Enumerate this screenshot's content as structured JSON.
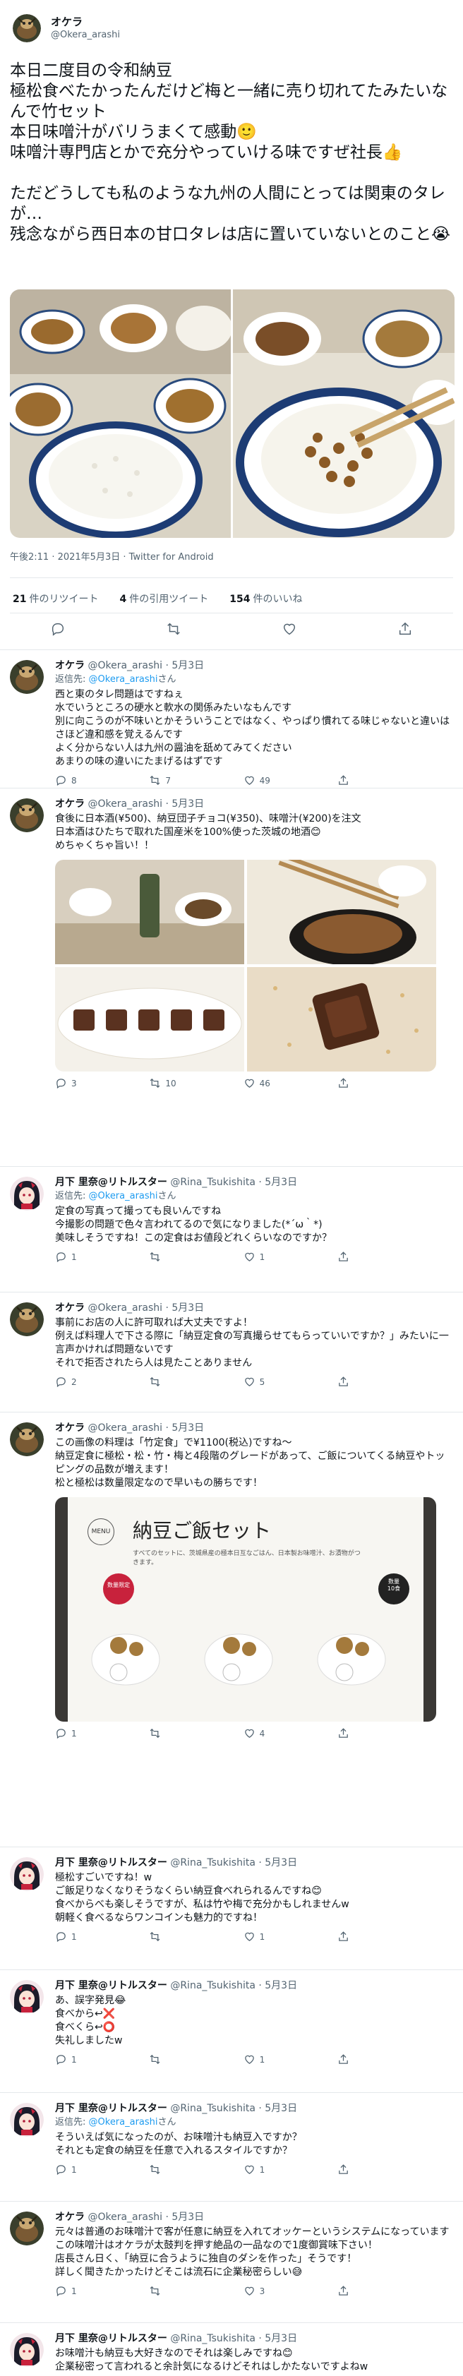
{
  "main": {
    "name": "オケラ",
    "handle": "@Okera_arashi",
    "text": "本日二度目の令和納豆\n極松食べたかったんだけど梅と一緒に売り切れてたみたいなんで竹セット\n本日味噌汁がバリうまくて感動🙂\n味噌汁専門店とかで充分やっていける味ですぜ社長👍\n\nただどうしても私のような九州の人間にとっては関東のタレが…\n残念ながら西日本の甘口タレは店に置いていないとのこと😭",
    "meta": "午後2:11 · 2021年5月3日 · Twitter for Android",
    "retweets_count": "21",
    "retweets_label": "件のリツイート",
    "quotes_count": "4",
    "quotes_label": "件の引用ツイート",
    "likes_count": "154",
    "likes_label": "件のいいね"
  },
  "replies": [
    {
      "name": "オケラ",
      "handle": "@Okera_arashi",
      "time": "· 5月3日",
      "replyto_prefix": "返信先: ",
      "replyto": "@Okera_arashi",
      "replyto_suffix": "さん",
      "text": "西と東のタレ問題はですねぇ\n水でいうところの硬水と軟水の関係みたいなもんです\n別に向こうのが不味いとかそういうことではなく、やっぱり慣れてる味じゃないと違いはさほど違和感を覚えるんです\nよく分からない人は九州の醤油を舐めてみてください\nあまりの味の違いにたまげるはずです",
      "reply_count": "8",
      "retweet_count": "7",
      "like_count": "49"
    },
    {
      "name": "オケラ",
      "handle": "@Okera_arashi",
      "time": "· 5月3日",
      "text": "食後に日本酒(¥500)、納豆団子チョコ(¥350)、味噌汁(¥200)を注文\n日本酒はひたちで取れた国産米を100%使った茨城の地酒😊\nめちゃくちゃ旨い！！",
      "reply_count": "3",
      "retweet_count": "10",
      "like_count": "46"
    },
    {
      "name": "月下 里奈@リトルスター",
      "handle": "@Rina_Tsukishita",
      "time": "· 5月3日",
      "replyto_prefix": "返信先: ",
      "replyto": "@Okera_arashi",
      "replyto_suffix": "さん",
      "text": "定食の写真って撮っても良いんですね\n今撮影の問題で色々言われてるので気になりました(*´ω｀*)\n美味しそうですね！この定食はお値段どれくらいなのですか？",
      "reply_count": "1",
      "retweet_count": "",
      "like_count": "1"
    },
    {
      "name": "オケラ",
      "handle": "@Okera_arashi",
      "time": "· 5月3日",
      "text": "事前にお店の人に許可取れば大丈夫ですよ！\n例えば料理人で下さる際に「納豆定食の写真撮らせてもらっていいですか？」みたいに一言声かければ問題ないです\nそれで拒否されたら人は見たことありません",
      "reply_count": "2",
      "retweet_count": "",
      "like_count": "5"
    },
    {
      "name": "オケラ",
      "handle": "@Okera_arashi",
      "time": "· 5月3日",
      "text": "この画像の料理は「竹定食」で¥1100(税込)ですね～\n納豆定食に極松・松・竹・梅と4段階のグレードがあって、ご飯についてくる納豆やトッピングの品数が増えます！\n松と極松は数量限定なので早いもの勝ちです！",
      "menu_title": "納豆ご飯セット",
      "menu_tag": "MENU",
      "menu_caption": "すべてのセットに、茨城県産の極本日互なごはん、日本製お味噌汁、お漬物がつきます。",
      "badge1": "数量限定",
      "badge2": "数量\n10食",
      "reply_count": "1",
      "retweet_count": "",
      "like_count": "4"
    },
    {
      "name": "月下 里奈@リトルスター",
      "handle": "@Rina_Tsukishita",
      "time": "· 5月3日",
      "text": "極松すごいですね！w\nご飯足りなくなりそうなくらい納豆食べれられるんですね😊\n食べからべも楽しそうですが、私は竹や梅で充分かもしれませんw\n朝軽く食べるならワンコインも魅力的ですね！",
      "reply_count": "1",
      "retweet_count": "",
      "like_count": "1"
    },
    {
      "name": "月下 里奈@リトルスター",
      "handle": "@Rina_Tsukishita",
      "time": "· 5月3日",
      "text": "あ、誤字発見😂\n食べから↩❌\n食べくら↩⭕\n失礼しましたw",
      "reply_count": "1",
      "retweet_count": "",
      "like_count": "1"
    },
    {
      "name": "月下 里奈@リトルスター",
      "handle": "@Rina_Tsukishita",
      "time": "· 5月3日",
      "replyto_prefix": "返信先: ",
      "replyto": "@Okera_arashi",
      "replyto_suffix": "さん",
      "text": "そういえば気になったのが、お味噌汁も納豆入ですか？\nそれとも定食の納豆を任意で入れるスタイルですか？",
      "reply_count": "1",
      "retweet_count": "",
      "like_count": "1"
    },
    {
      "name": "オケラ",
      "handle": "@Okera_arashi",
      "time": "· 5月3日",
      "text": "元々は普通のお味噌汁で客が任意に納豆を入れてオッケーというシステムになっています\nこの味噌汁はオケラが太鼓判を押す絶品の一品なので1度御賞味下さい！\n店長さん日く、「納豆に合うように独自のダシを作った」そうです！\n詳しく聞きたかったけどそこは流石に企業秘密らしい😅",
      "reply_count": "1",
      "retweet_count": "",
      "like_count": "3"
    },
    {
      "name": "月下 里奈@リトルスター",
      "handle": "@Rina_Tsukishita",
      "time": "· 5月3日",
      "text": "お味噌汁も納豆も大好きなのでそれは楽しみですね😊\n企業秘密って言われると余計気になるけどそれはしかたないですよねw",
      "reply_count": "",
      "retweet_count": "",
      "like_count": ""
    }
  ],
  "colors": {
    "accent": "#1d9bf0",
    "muted": "#536471",
    "text": "#0f1419",
    "divider": "#e4e8eb"
  },
  "icons": [
    "reply-icon",
    "retweet-icon",
    "like-icon",
    "share-icon"
  ]
}
